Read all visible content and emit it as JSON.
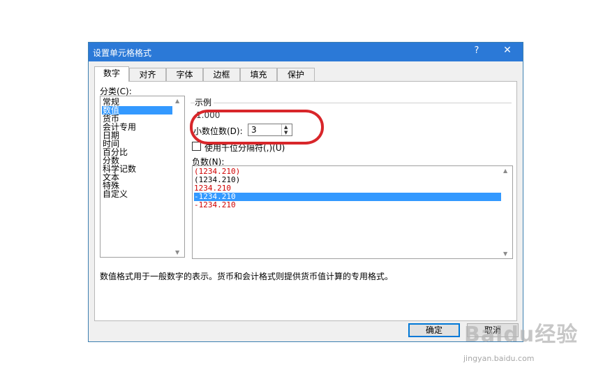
{
  "window": {
    "title": "设置单元格格式",
    "help": "?",
    "close": "✕"
  },
  "tabs": [
    "数字",
    "对齐",
    "字体",
    "边框",
    "填充",
    "保护"
  ],
  "category": {
    "label": "分类(C):",
    "items": [
      "常规",
      "数值",
      "货币",
      "会计专用",
      "日期",
      "时间",
      "百分比",
      "分数",
      "科学记数",
      "文本",
      "特殊",
      "自定义"
    ],
    "selected_index": 1
  },
  "example": {
    "label": "示例",
    "value": "1.000"
  },
  "decimal": {
    "label": "小数位数(D):",
    "value": "3"
  },
  "separator": {
    "label": "使用千位分隔符(,)(U)",
    "checked": false
  },
  "negative": {
    "label": "负数(N):",
    "items": [
      {
        "text": "(1234.210)",
        "color": "red"
      },
      {
        "text": "(1234.210)",
        "color": "black"
      },
      {
        "text": "1234.210",
        "color": "red"
      },
      {
        "text": "-1234.210",
        "color": "black"
      },
      {
        "text": "-1234.210",
        "color": "red"
      }
    ],
    "selected_index": 3
  },
  "description": "数值格式用于一般数字的表示。货币和会计格式则提供货币值计算的专用格式。",
  "buttons": {
    "ok": "确定",
    "cancel": "取消"
  },
  "watermark": {
    "logo": "Baidu经验",
    "url": "jingyan.baidu.com"
  },
  "colors": {
    "titlebar": "#2b79d7",
    "selection": "#3399ff",
    "annotation": "#d8262a",
    "negative_red": "#d00000"
  }
}
